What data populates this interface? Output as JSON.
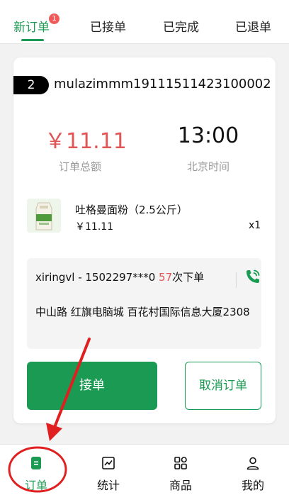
{
  "tabs": [
    {
      "label": "新订单",
      "badge": "1"
    },
    {
      "label": "已接单"
    },
    {
      "label": "已完成"
    },
    {
      "label": "已退单"
    }
  ],
  "order": {
    "number": "2",
    "id": "mulazimmm19111511423100002",
    "amount_value": "￥11.11",
    "amount_label": "订单总额",
    "time_value": "13:00",
    "time_label": "北京时间",
    "product": {
      "name": "吐格曼面粉（2.5公斤）",
      "price": "￥11.11",
      "qty": "x1"
    },
    "customer": {
      "name": "xiringvl",
      "sep": " - ",
      "phone": "1502297***0",
      "order_count": "57",
      "order_count_suffix": "次下单",
      "address": "中山路 红旗电脑城 百花村国际信息大厦2308"
    },
    "accept_label": "接单",
    "cancel_label": "取消订单"
  },
  "bottom_nav": [
    {
      "label": "订单",
      "icon": "order-list-icon"
    },
    {
      "label": "统计",
      "icon": "chart-icon"
    },
    {
      "label": "商品",
      "icon": "grid-icon"
    },
    {
      "label": "我的",
      "icon": "user-icon"
    }
  ],
  "colors": {
    "accent": "#1a9a52",
    "price": "#e05555",
    "annotation": "#e02020"
  }
}
